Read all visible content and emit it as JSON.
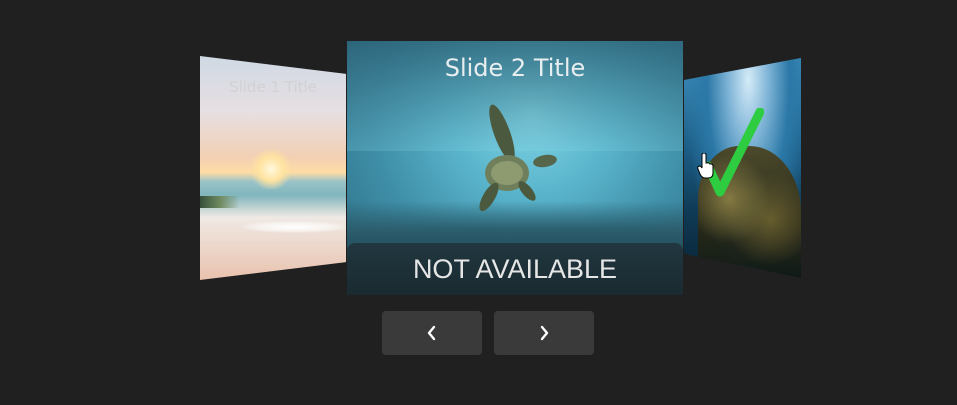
{
  "carousel": {
    "slides": [
      {
        "title": "Slide 1 Title"
      },
      {
        "title": "Slide 2 Title",
        "caption": "NOT AVAILABLE"
      },
      {
        "title": ""
      }
    ],
    "active_index": 1
  },
  "overlay": {
    "check_color": "#2ecc40"
  },
  "controls": {
    "prev_icon": "chevron-left-icon",
    "next_icon": "chevron-right-icon"
  },
  "colors": {
    "background": "#202020",
    "button": "#3a3a3a"
  }
}
